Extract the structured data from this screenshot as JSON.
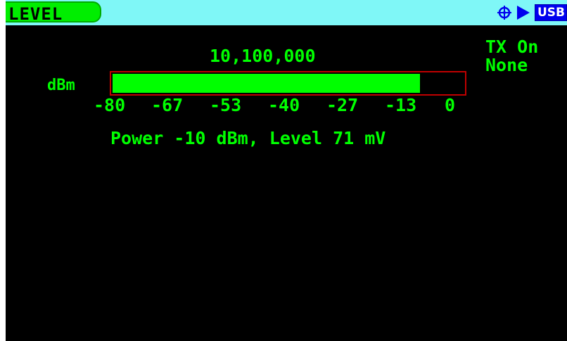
{
  "header": {
    "mode_label": "LEVEL",
    "status_icons": [
      "crosshair-icon",
      "play-icon"
    ],
    "usb_label": "USB"
  },
  "display": {
    "frequency": "10,100,000",
    "tx_status": "TX On",
    "modulation_status": "None"
  },
  "meter": {
    "unit_label": "dBm",
    "level_fraction": 0.875,
    "scale": [
      "-80",
      "-67",
      "-53",
      "-40",
      "-27",
      "-13",
      "0"
    ]
  },
  "readout": {
    "text": "Power -10 dBm, Level 71 mV"
  },
  "colors": {
    "screen_bg": "#000000",
    "topbar_bg": "#7ff7f7",
    "mode_tab": "#00ee00",
    "text_green": "#00ff00",
    "meter_frame": "#c00000",
    "usb_badge": "#0000ee"
  }
}
